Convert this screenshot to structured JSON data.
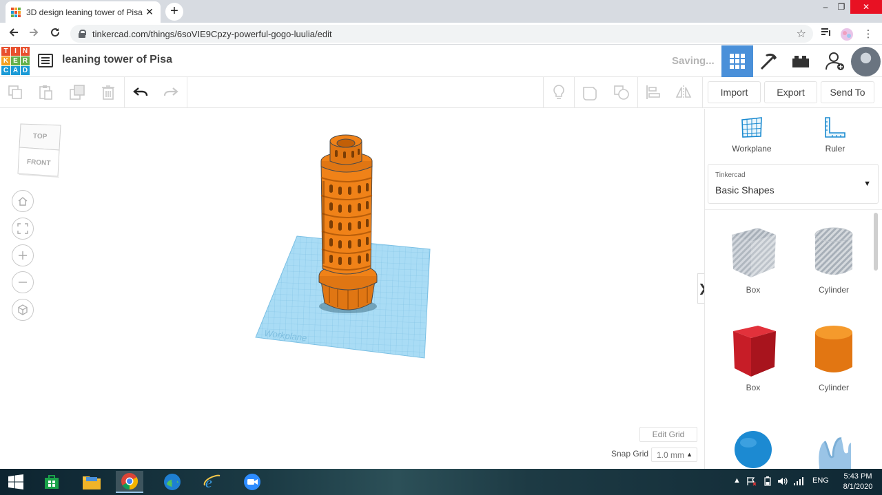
{
  "browser": {
    "tab_title": "3D design leaning tower of Pisa |",
    "tab_close": "✕",
    "new_tab": "+",
    "url": "tinkercad.com/things/6soVIE9Cpzy-powerful-gogo-luulia/edit",
    "window_controls": {
      "minimize": "–",
      "restore": "❐",
      "close": "✕"
    }
  },
  "header": {
    "logo_letters": [
      "T",
      "I",
      "N",
      "K",
      "E",
      "R",
      "C",
      "A",
      "D"
    ],
    "design_title": "leaning tower of Pisa",
    "status": "Saving..."
  },
  "toolbar": {
    "import": "Import",
    "export": "Export",
    "send_to": "Send To"
  },
  "canvas": {
    "viewcube": {
      "top": "TOP",
      "front": "FRONT"
    },
    "workplane_text": "Workplane",
    "edit_grid": "Edit Grid",
    "snap_grid_label": "Snap Grid",
    "snap_grid_value": "1.0 mm",
    "snap_caret": "▲",
    "collapse": "❯"
  },
  "panel": {
    "tools": [
      {
        "label": "Workplane",
        "icon": "workplane-icon"
      },
      {
        "label": "Ruler",
        "icon": "ruler-icon"
      }
    ],
    "library_source": "Tinkercad",
    "library_name": "Basic Shapes",
    "library_caret": "▼",
    "shapes": [
      {
        "label": "Box",
        "color": "#b5bcc4"
      },
      {
        "label": "Cylinder",
        "color": "#c4c9cf"
      },
      {
        "label": "Box",
        "color": "#d51f2a"
      },
      {
        "label": "Cylinder",
        "color": "#f08218"
      },
      {
        "label": "",
        "color": "#1c8ad2"
      },
      {
        "label": "",
        "color": "#9ac4e6"
      }
    ]
  },
  "taskbar": {
    "language": "ENG",
    "time": "5:43 PM",
    "date": "8/1/2020"
  },
  "colors": {
    "accent_blue": "#4a90d9",
    "tower_orange": "#f08218",
    "workplane_blue": "#9fd5f0"
  }
}
